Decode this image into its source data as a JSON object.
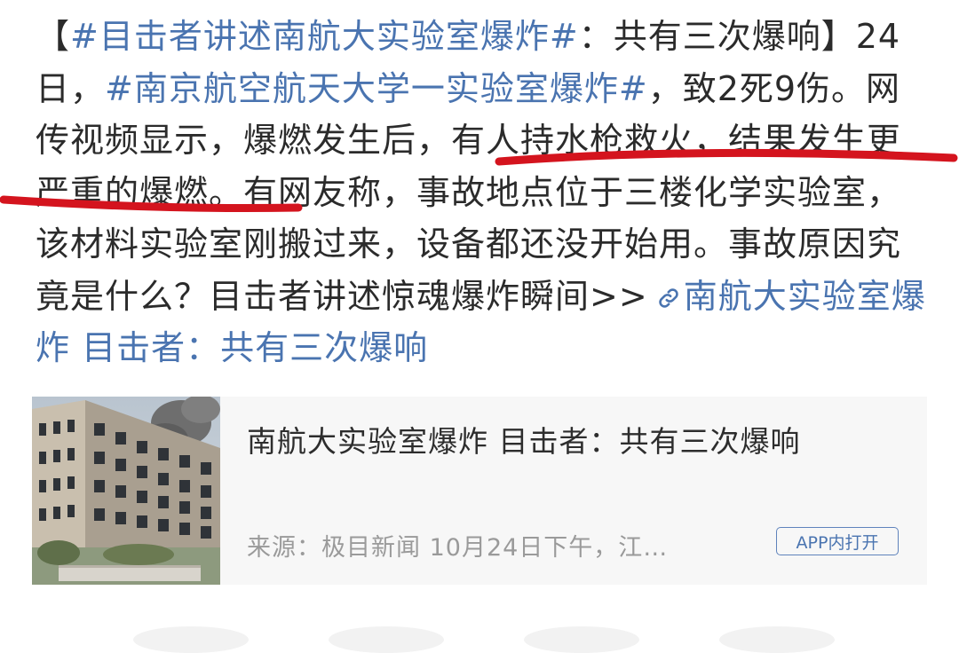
{
  "post": {
    "part1": "【",
    "topic1": "#目击者讲述南航大实验室爆炸#",
    "part2": "：共有三次爆响】24日，",
    "topic2": "#南京航空航天大学一实验室爆炸#",
    "part3": "，致2死9伤。网传视频显示，爆燃发生后，有人持水枪救火，结果发生更严重的爆燃。有网友称，事故地点位于三楼化学实验室，该材料实验室刚搬过来，设备都还没开始用。事故原因究竟是什么？目击者讲述惊魂爆炸瞬间>>",
    "link_text": "南航大实验室爆炸 目击者：共有三次爆响",
    "link_icon": "link-icon"
  },
  "card": {
    "title": "南航大实验室爆炸 目击者：共有三次爆响",
    "meta": "来源：极目新闻 10月24日下午，江…",
    "button": "APP内打开",
    "thumb_icon": "building-smoke-image"
  },
  "colors": {
    "topic": "#4a74b0",
    "text": "#2b2b2b",
    "underline": "#d4141e",
    "card_bg": "#f7f7f7",
    "meta": "#9a9a9a"
  }
}
